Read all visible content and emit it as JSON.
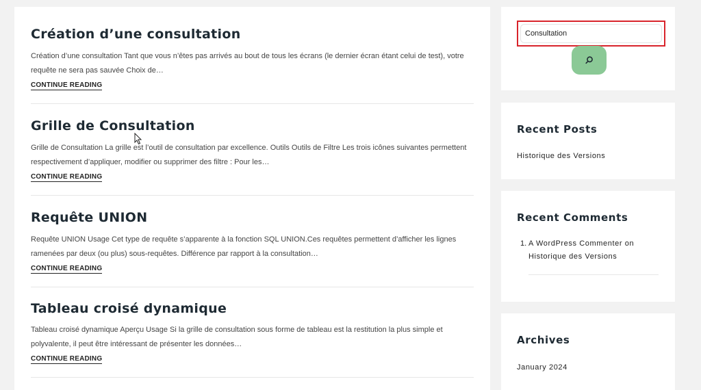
{
  "posts": [
    {
      "title": "Création d’une consultation",
      "excerpt": "Création d’une consultation Tant que vous n’êtes pas arrivés au bout de tous les écrans (le dernier écran étant celui de test), votre requête ne sera pas sauvée Choix de…",
      "continue": "CONTINUE READING"
    },
    {
      "title": "Grille de Consultation",
      "excerpt": "Grille de Consultation La grille est l’outil de consultation par excellence. Outils Outils de Filtre Les trois icônes suivantes permettent respectivement d’appliquer, modifier ou supprimer des filtre : Pour les…",
      "continue": "CONTINUE READING"
    },
    {
      "title": "Requête UNION",
      "excerpt": "Requête UNION Usage Cet type de requête s’apparente à la fonction SQL UNION.Ces requêtes permettent d’afficher les lignes ramenées par deux (ou plus) sous-requêtes. Différence par rapport à la consultation…",
      "continue": "CONTINUE READING"
    },
    {
      "title": "Tableau croisé dynamique",
      "excerpt": "Tableau croisé dynamique Aperçu Usage Si la grille de consultation sous forme de tableau est la restitution la plus simple et polyvalente, il peut être intéressant de présenter les données…",
      "continue": "CONTINUE READING"
    }
  ],
  "search": {
    "value": "Consultation",
    "highlight_color": "#d8232a",
    "button_color": "#8bc996",
    "button_icon": "search-icon"
  },
  "recent_posts": {
    "title": "Recent Posts",
    "items": [
      "Historique des Versions"
    ]
  },
  "recent_comments": {
    "title": "Recent Comments",
    "number": "1.",
    "author": "A WordPress Commenter",
    "on": "on",
    "post": "Historique des Versions"
  },
  "archives": {
    "title": "Archives",
    "items": [
      "January 2024"
    ]
  }
}
